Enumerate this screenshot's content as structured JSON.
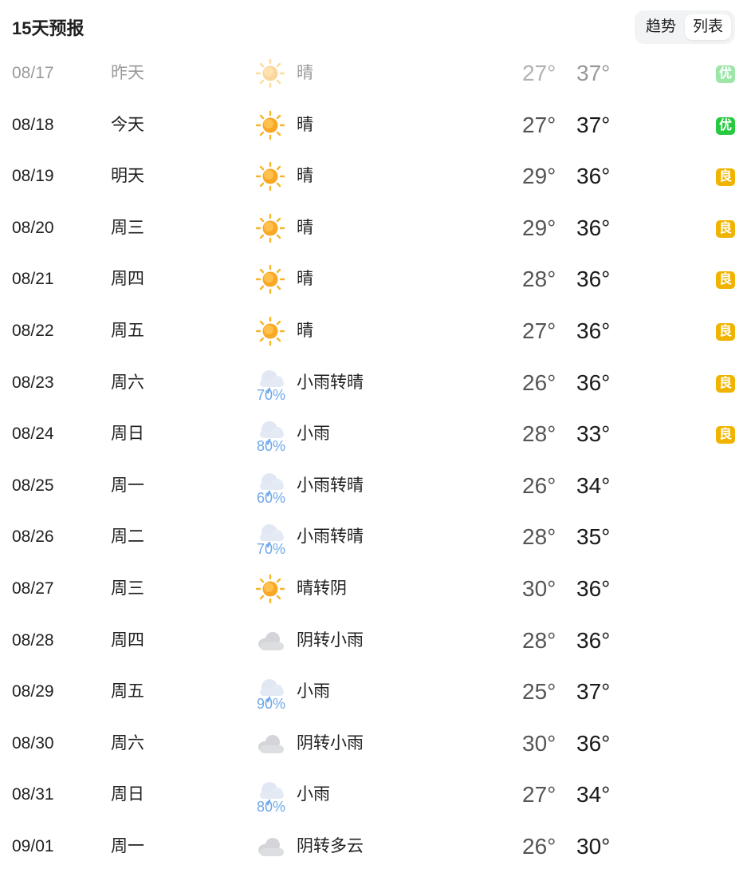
{
  "header": {
    "title": "15天预报",
    "toggle_trend": "趋势",
    "toggle_list": "列表"
  },
  "colors": {
    "aqi_good": "#27c93f",
    "aqi_fair": "#f0b400",
    "precip": "#6fa8ea"
  },
  "forecast": [
    {
      "date": "08/17",
      "week": "昨天",
      "icon": "sun-icon",
      "pop": "",
      "desc": "晴",
      "low": "27°",
      "high": "37°",
      "aqi": "优",
      "aqi_level": "good",
      "past": true
    },
    {
      "date": "08/18",
      "week": "今天",
      "icon": "sun-icon",
      "pop": "",
      "desc": "晴",
      "low": "27°",
      "high": "37°",
      "aqi": "优",
      "aqi_level": "good",
      "past": false
    },
    {
      "date": "08/19",
      "week": "明天",
      "icon": "sun-icon",
      "pop": "",
      "desc": "晴",
      "low": "29°",
      "high": "36°",
      "aqi": "良",
      "aqi_level": "fair",
      "past": false
    },
    {
      "date": "08/20",
      "week": "周三",
      "icon": "sun-icon",
      "pop": "",
      "desc": "晴",
      "low": "29°",
      "high": "36°",
      "aqi": "良",
      "aqi_level": "fair",
      "past": false
    },
    {
      "date": "08/21",
      "week": "周四",
      "icon": "sun-icon",
      "pop": "",
      "desc": "晴",
      "low": "28°",
      "high": "36°",
      "aqi": "良",
      "aqi_level": "fair",
      "past": false
    },
    {
      "date": "08/22",
      "week": "周五",
      "icon": "sun-icon",
      "pop": "",
      "desc": "晴",
      "low": "27°",
      "high": "36°",
      "aqi": "良",
      "aqi_level": "fair",
      "past": false
    },
    {
      "date": "08/23",
      "week": "周六",
      "icon": "rain-cloud-icon",
      "pop": "70%",
      "desc": "小雨转晴",
      "low": "26°",
      "high": "36°",
      "aqi": "良",
      "aqi_level": "fair",
      "past": false
    },
    {
      "date": "08/24",
      "week": "周日",
      "icon": "rain-cloud-icon",
      "pop": "80%",
      "desc": "小雨",
      "low": "28°",
      "high": "33°",
      "aqi": "良",
      "aqi_level": "fair",
      "past": false
    },
    {
      "date": "08/25",
      "week": "周一",
      "icon": "rain-cloud-icon",
      "pop": "60%",
      "desc": "小雨转晴",
      "low": "26°",
      "high": "34°",
      "aqi": "",
      "aqi_level": "",
      "past": false
    },
    {
      "date": "08/26",
      "week": "周二",
      "icon": "rain-cloud-icon",
      "pop": "70%",
      "desc": "小雨转晴",
      "low": "28°",
      "high": "35°",
      "aqi": "",
      "aqi_level": "",
      "past": false
    },
    {
      "date": "08/27",
      "week": "周三",
      "icon": "sun-icon",
      "pop": "",
      "desc": "晴转阴",
      "low": "30°",
      "high": "36°",
      "aqi": "",
      "aqi_level": "",
      "past": false
    },
    {
      "date": "08/28",
      "week": "周四",
      "icon": "cloud-icon",
      "pop": "",
      "desc": "阴转小雨",
      "low": "28°",
      "high": "36°",
      "aqi": "",
      "aqi_level": "",
      "past": false
    },
    {
      "date": "08/29",
      "week": "周五",
      "icon": "rain-cloud-icon",
      "pop": "90%",
      "desc": "小雨",
      "low": "25°",
      "high": "37°",
      "aqi": "",
      "aqi_level": "",
      "past": false
    },
    {
      "date": "08/30",
      "week": "周六",
      "icon": "cloud-icon",
      "pop": "",
      "desc": "阴转小雨",
      "low": "30°",
      "high": "36°",
      "aqi": "",
      "aqi_level": "",
      "past": false
    },
    {
      "date": "08/31",
      "week": "周日",
      "icon": "rain-cloud-icon",
      "pop": "80%",
      "desc": "小雨",
      "low": "27°",
      "high": "34°",
      "aqi": "",
      "aqi_level": "",
      "past": false
    },
    {
      "date": "09/01",
      "week": "周一",
      "icon": "cloud-icon",
      "pop": "",
      "desc": "阴转多云",
      "low": "26°",
      "high": "30°",
      "aqi": "",
      "aqi_level": "",
      "past": false
    }
  ]
}
